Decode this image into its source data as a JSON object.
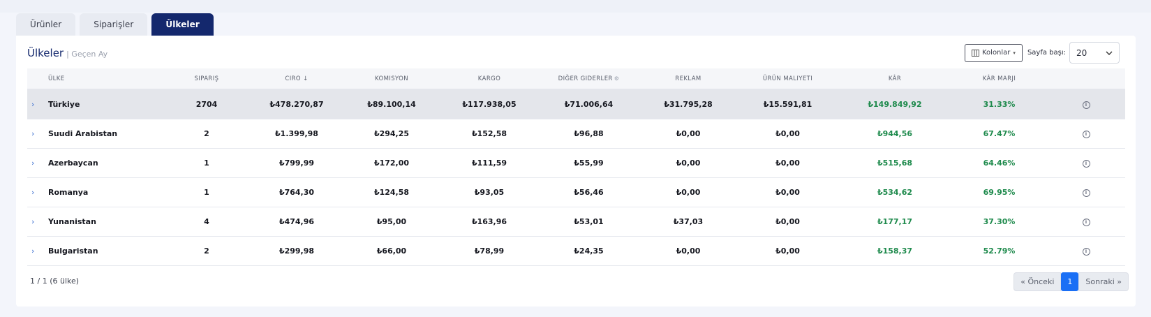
{
  "tabs": [
    {
      "label": "Ürünler",
      "active": false
    },
    {
      "label": "Siparişler",
      "active": false
    },
    {
      "label": "Ülkeler",
      "active": true
    }
  ],
  "card": {
    "title": "Ülkeler",
    "subtitle": "| Geçen Ay",
    "columns_button": "Kolonlar",
    "per_page_label": "Sayfa başı:",
    "per_page_value": "20"
  },
  "table": {
    "headers": {
      "country": "ÜLKE",
      "orders": "SIPARIŞ",
      "revenue": "CIRO ↓",
      "commission": "KOMISYON",
      "shipping": "KARGO",
      "other": "DIĞER GIDERLER",
      "ads": "REKLAM",
      "cost": "ÜRÜN MALIYETI",
      "profit": "KÂR",
      "margin": "KÂR MARJI"
    },
    "rows": [
      {
        "country": "Türkiye",
        "orders": "2704",
        "revenue": "₺478.270,87",
        "commission": "₺89.100,14",
        "shipping": "₺117.938,05",
        "other": "₺71.006,64",
        "ads": "₺31.795,28",
        "cost": "₺15.591,81",
        "profit": "₺149.849,92",
        "margin": "31.33%"
      },
      {
        "country": "Suudi Arabistan",
        "orders": "2",
        "revenue": "₺1.399,98",
        "commission": "₺294,25",
        "shipping": "₺152,58",
        "other": "₺96,88",
        "ads": "₺0,00",
        "cost": "₺0,00",
        "profit": "₺944,56",
        "margin": "67.47%"
      },
      {
        "country": "Azerbaycan",
        "orders": "1",
        "revenue": "₺799,99",
        "commission": "₺172,00",
        "shipping": "₺111,59",
        "other": "₺55,99",
        "ads": "₺0,00",
        "cost": "₺0,00",
        "profit": "₺515,68",
        "margin": "64.46%"
      },
      {
        "country": "Romanya",
        "orders": "1",
        "revenue": "₺764,30",
        "commission": "₺124,58",
        "shipping": "₺93,05",
        "other": "₺56,46",
        "ads": "₺0,00",
        "cost": "₺0,00",
        "profit": "₺534,62",
        "margin": "69.95%"
      },
      {
        "country": "Yunanistan",
        "orders": "4",
        "revenue": "₺474,96",
        "commission": "₺95,00",
        "shipping": "₺163,96",
        "other": "₺53,01",
        "ads": "₺37,03",
        "cost": "₺0,00",
        "profit": "₺177,17",
        "margin": "37.30%"
      },
      {
        "country": "Bulgaristan",
        "orders": "2",
        "revenue": "₺299,98",
        "commission": "₺66,00",
        "shipping": "₺78,99",
        "other": "₺24,35",
        "ads": "₺0,00",
        "cost": "₺0,00",
        "profit": "₺158,37",
        "margin": "52.79%"
      }
    ]
  },
  "footer": {
    "summary": "1 / 1 (6 ülke)",
    "prev": "« Önceki",
    "page": "1",
    "next": "Sonraki »"
  },
  "colors": {
    "accent": "#14286d",
    "profit_green": "#1e8a4c",
    "pager_active": "#1a6ff5"
  }
}
